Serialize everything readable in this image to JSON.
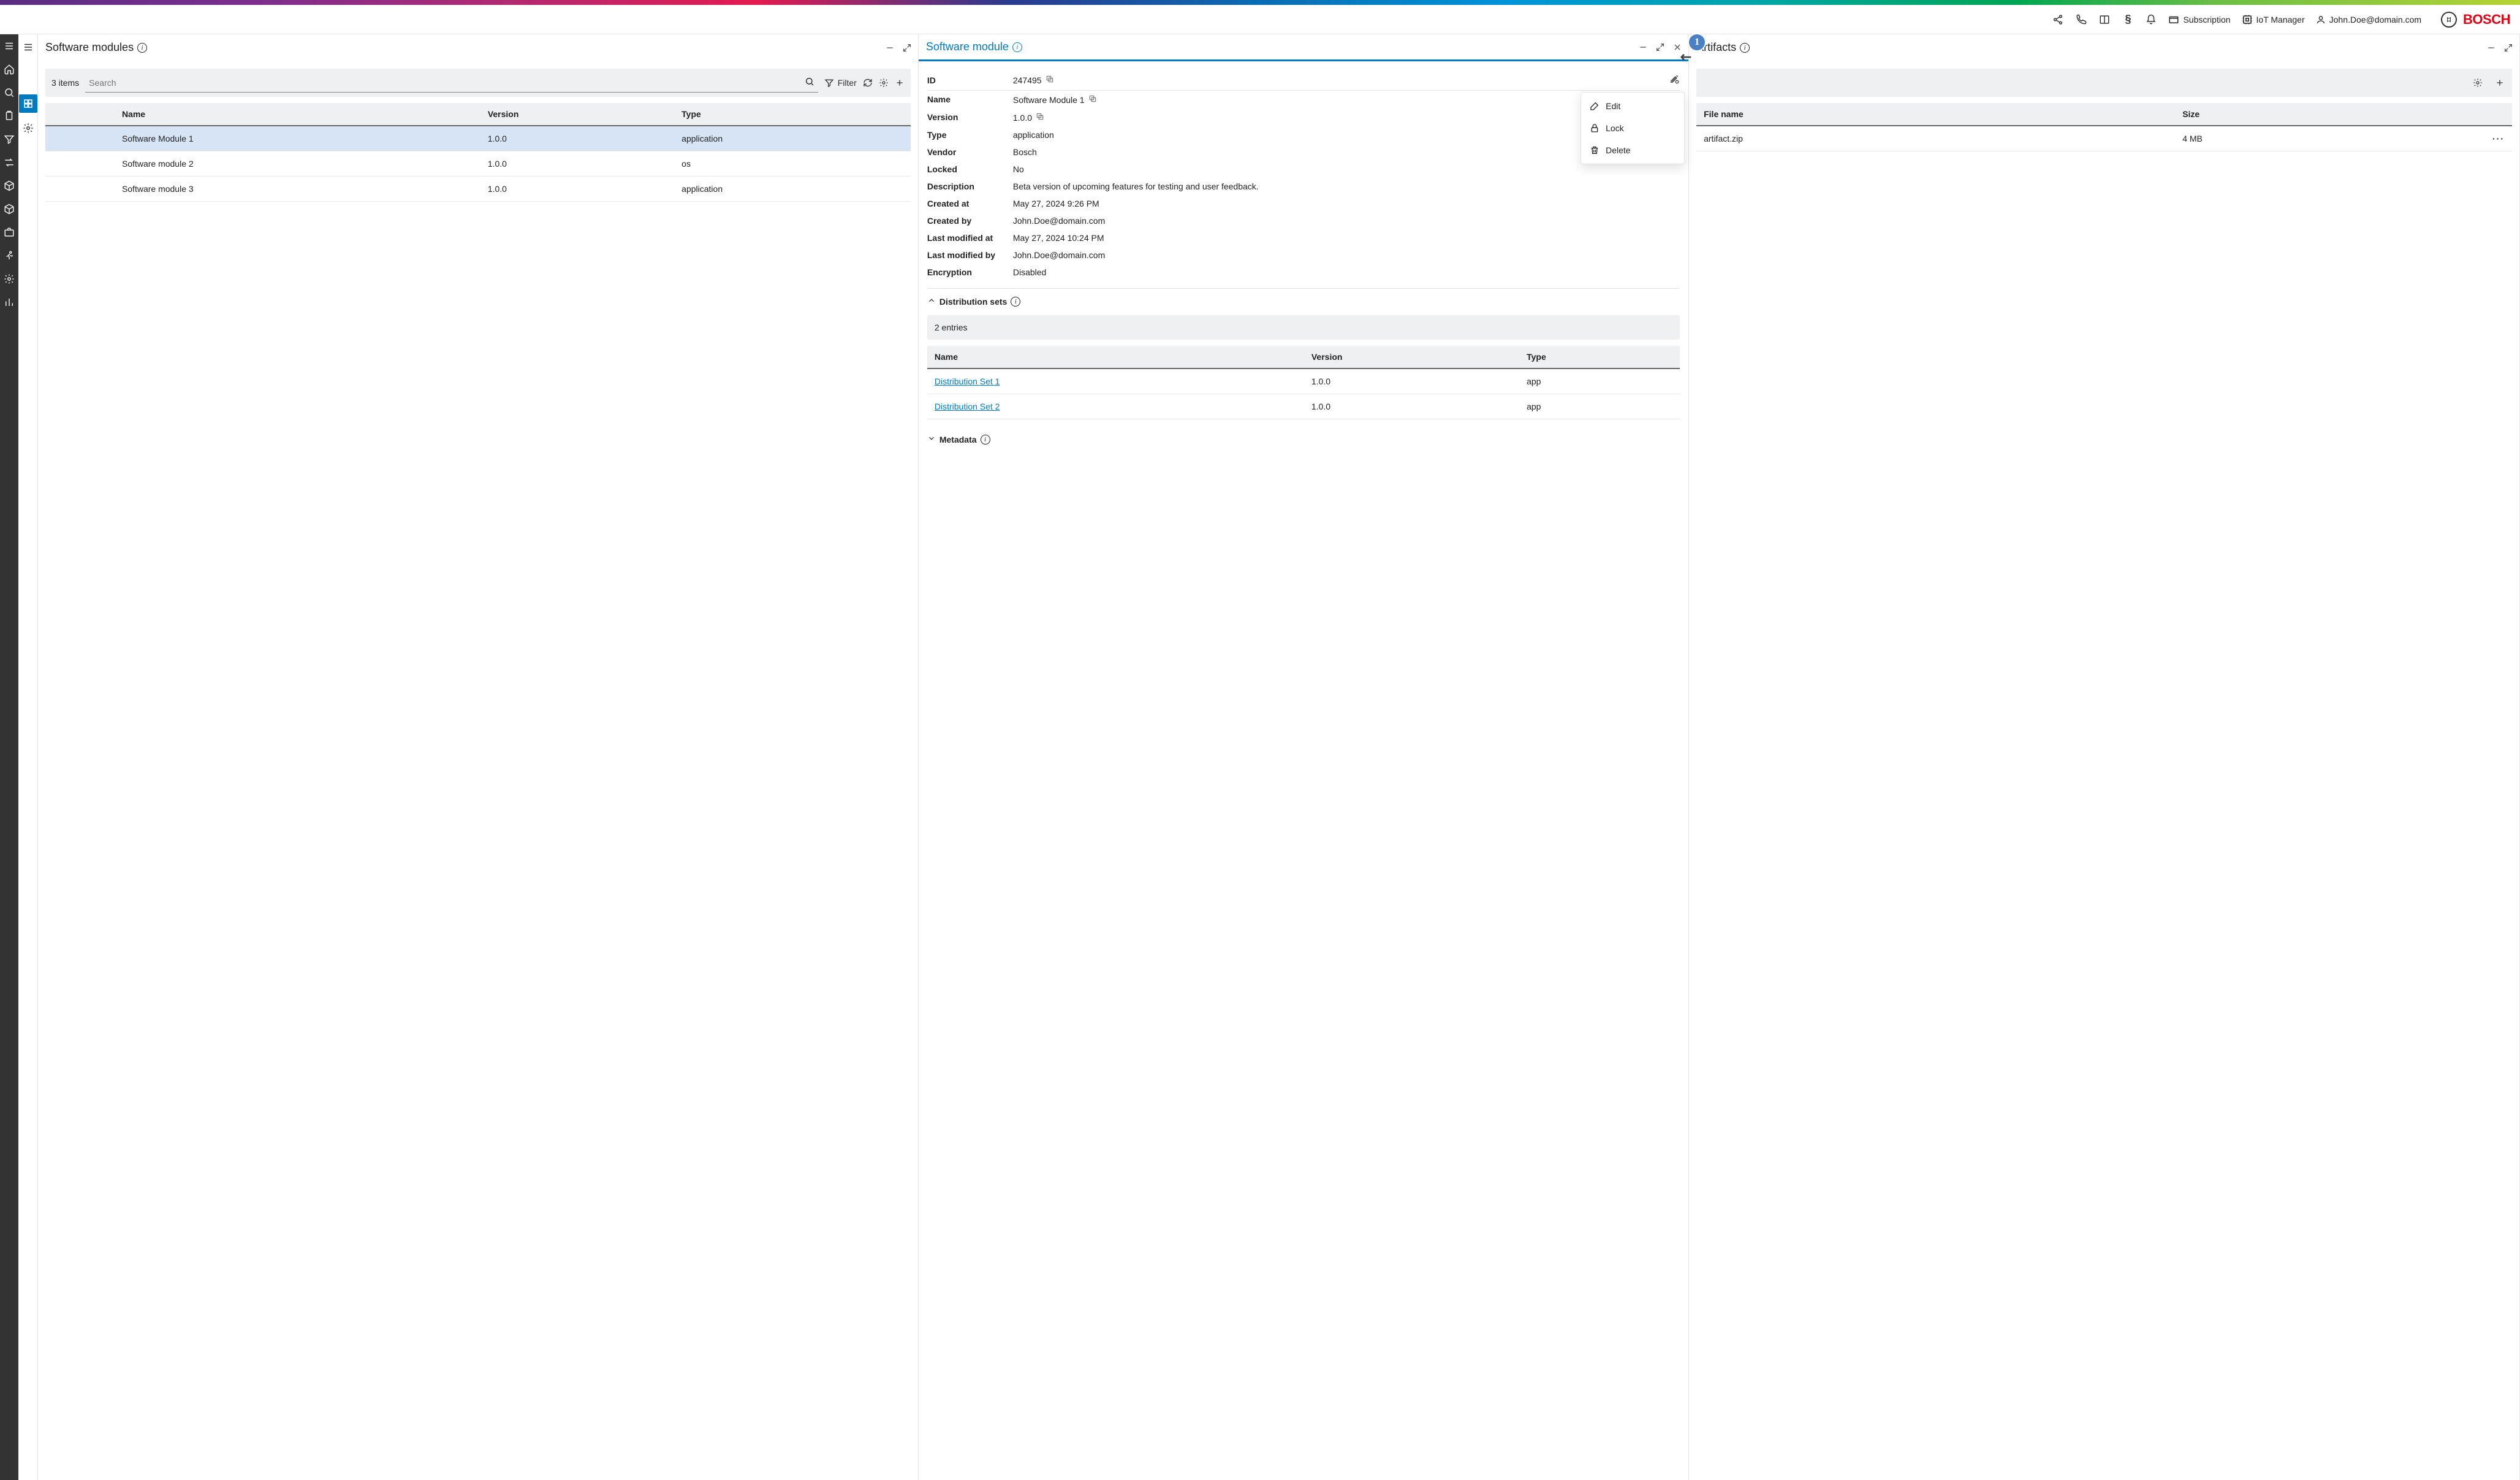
{
  "header": {
    "subscription": "Subscription",
    "iot_manager": "IoT Manager",
    "user": "John.Doe@domain.com",
    "brand": "BOSCH"
  },
  "list_panel": {
    "title": "Software modules",
    "count": "3 items",
    "search_placeholder": "Search",
    "filter_label": "Filter",
    "columns": {
      "name": "Name",
      "version": "Version",
      "type": "Type"
    },
    "rows": [
      {
        "name": "Software Module 1",
        "version": "1.0.0",
        "type": "application",
        "selected": true
      },
      {
        "name": "Software module 2",
        "version": "1.0.0",
        "type": "os",
        "selected": false
      },
      {
        "name": "Software module 3",
        "version": "1.0.0",
        "type": "application",
        "selected": false
      }
    ]
  },
  "detail_panel": {
    "title": "Software module",
    "fields": {
      "id_label": "ID",
      "id_value": "247495",
      "name_label": "Name",
      "name_value": "Software Module 1",
      "version_label": "Version",
      "version_value": "1.0.0",
      "type_label": "Type",
      "type_value": "application",
      "vendor_label": "Vendor",
      "vendor_value": "Bosch",
      "locked_label": "Locked",
      "locked_value": "No",
      "description_label": "Description",
      "description_value": "Beta version of upcoming features for testing and user feedback.",
      "created_at_label": "Created at",
      "created_at_value": "May 27, 2024 9:26 PM",
      "created_by_label": "Created by",
      "created_by_value": "John.Doe@domain.com",
      "last_modified_at_label": "Last modified at",
      "last_modified_at_value": "May 27, 2024 10:24 PM",
      "last_modified_by_label": "Last modified by",
      "last_modified_by_value": "John.Doe@domain.com",
      "encryption_label": "Encryption",
      "encryption_value": "Disabled"
    },
    "distribution": {
      "title": "Distribution sets",
      "count": "2 entries",
      "columns": {
        "name": "Name",
        "version": "Version",
        "type": "Type"
      },
      "rows": [
        {
          "name": "Distribution Set 1",
          "version": "1.0.0",
          "type": "app"
        },
        {
          "name": "Distribution Set 2",
          "version": "1.0.0",
          "type": "app"
        }
      ]
    },
    "metadata_title": "Metadata",
    "context_menu": {
      "edit": "Edit",
      "lock": "Lock",
      "delete": "Delete"
    },
    "step_badge": "1"
  },
  "artifacts_panel": {
    "title": "Artifacts",
    "columns": {
      "file": "File name",
      "size": "Size"
    },
    "rows": [
      {
        "file": "artifact.zip",
        "size": "4 MB"
      }
    ]
  }
}
